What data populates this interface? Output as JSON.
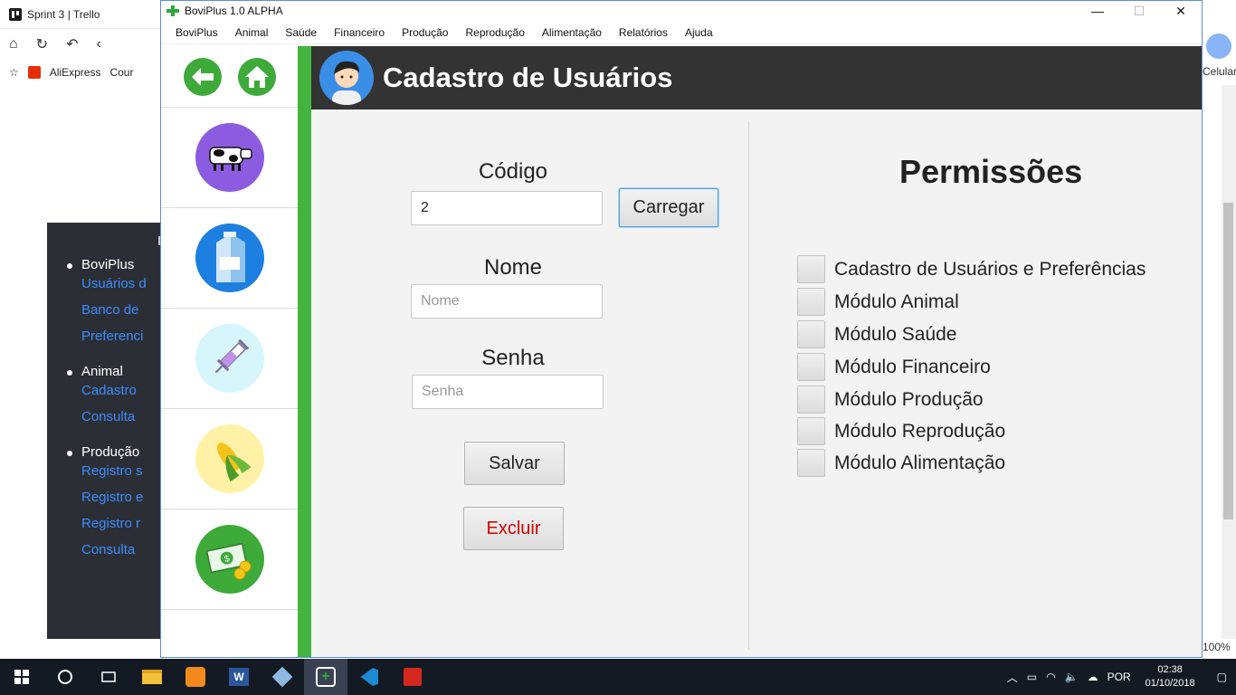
{
  "browser": {
    "tab_title": "Sprint 3 | Trello",
    "favorites": [
      "AliExpress",
      "Cour"
    ],
    "right_label": "Celular",
    "zoom": "100%",
    "sidebar": {
      "marker": "I",
      "sections": [
        {
          "title": "BoviPlus",
          "links": [
            "Usuários d",
            "Banco de",
            "Preferenci"
          ]
        },
        {
          "title": "Animal",
          "links": [
            "Cadastro",
            "Consulta"
          ]
        },
        {
          "title": "Produção",
          "links": [
            "Registro s",
            "Registro e",
            "Registro r",
            "Consulta"
          ]
        }
      ]
    }
  },
  "window": {
    "title": "BoviPlus 1.0 ALPHA",
    "controls": {
      "minimize": "—",
      "maximize": "☐",
      "close": "✕"
    },
    "menu": [
      "BoviPlus",
      "Animal",
      "Saúde",
      "Financeiro",
      "Produção",
      "Reprodução",
      "Alimentação",
      "Relatórios",
      "Ajuda"
    ]
  },
  "sidebar_modules": [
    "Animal",
    "Produção",
    "Saúde",
    "Alimentação",
    "Financeiro"
  ],
  "header": {
    "title": "Cadastro de Usuários"
  },
  "form": {
    "codigo_label": "Código",
    "codigo_value": "2",
    "carregar_label": "Carregar",
    "nome_label": "Nome",
    "nome_placeholder": "Nome",
    "senha_label": "Senha",
    "senha_placeholder": "Senha",
    "salvar_label": "Salvar",
    "excluir_label": "Excluir",
    "excluir_color": "#d40000"
  },
  "permissions": {
    "title": "Permissões",
    "items": [
      "Cadastro de Usuários e Preferências",
      "Módulo Animal",
      "Módulo Saúde",
      "Módulo Financeiro",
      "Módulo Produção",
      "Módulo Reprodução",
      "Módulo Alimentação"
    ]
  },
  "taskbar": {
    "language": "POR",
    "time": "02:38",
    "date": "01/10/2018"
  },
  "colors": {
    "accent_green": "#45b43f",
    "header_bg": "#333333"
  }
}
